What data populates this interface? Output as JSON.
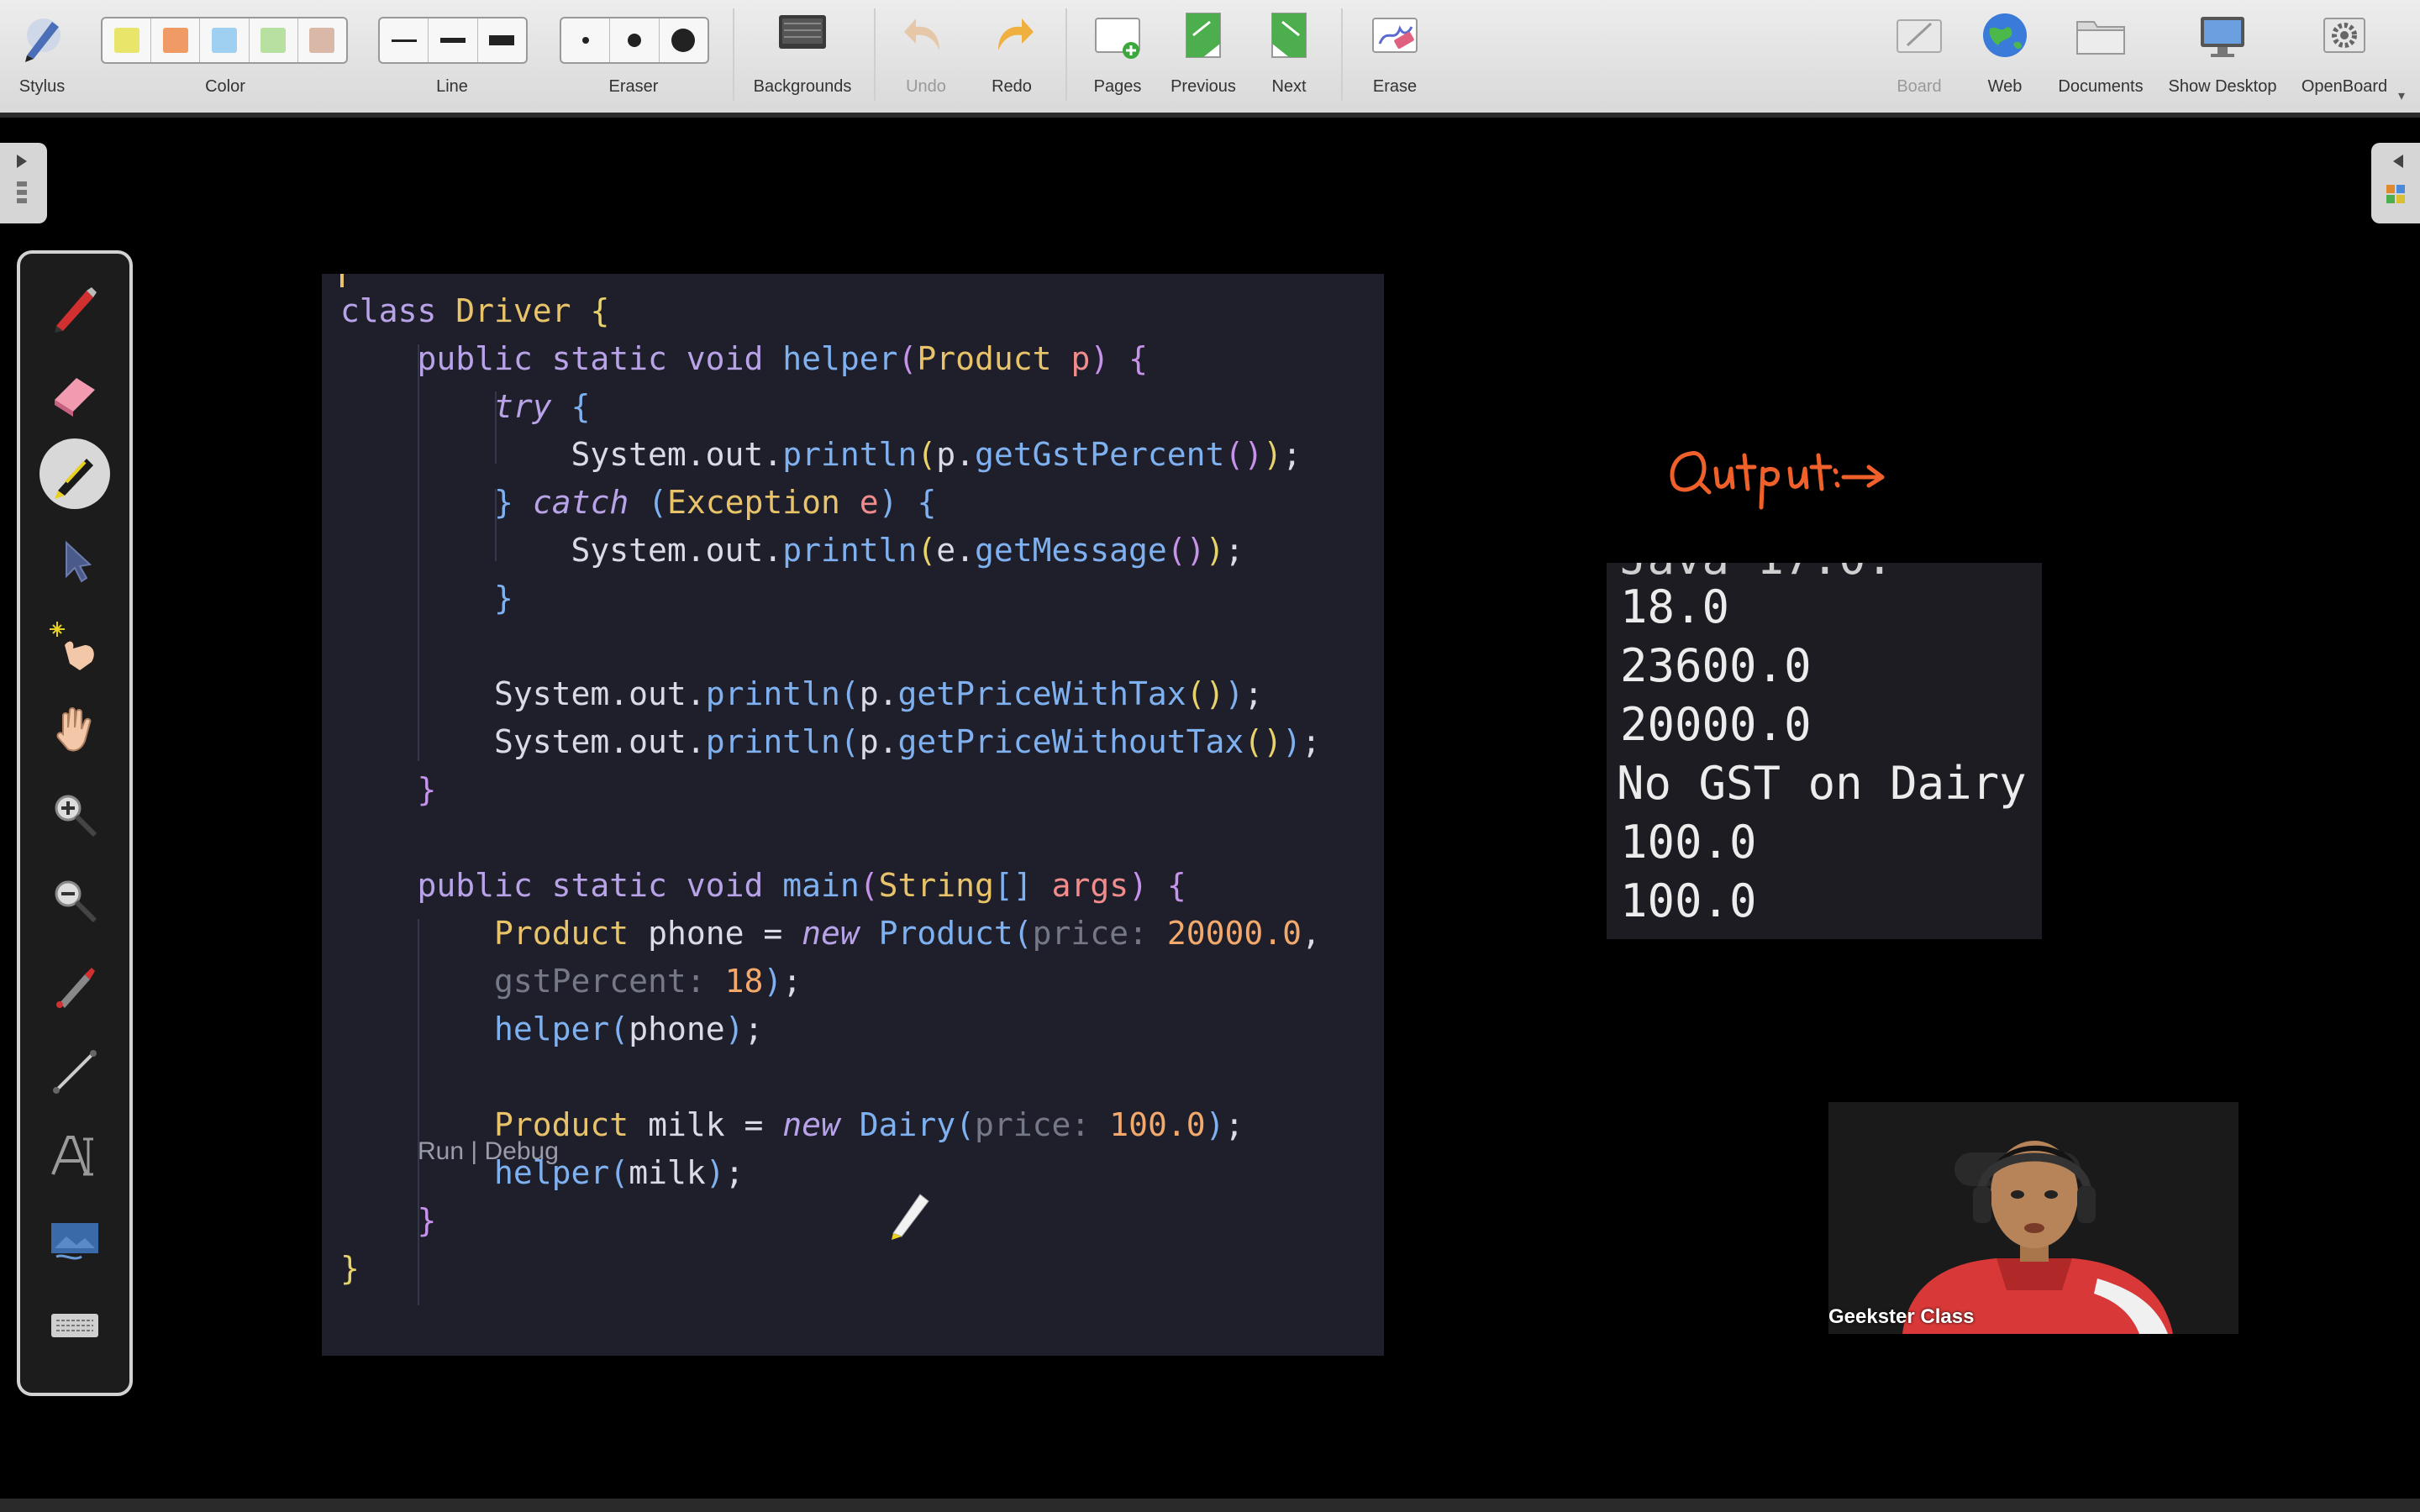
{
  "toolbar": {
    "stylus_label": "Stylus",
    "color_label": "Color",
    "colors": [
      "#e9e46a",
      "#f09a66",
      "#9fd0f2",
      "#b8e0a0",
      "#d9b8a8"
    ],
    "line_label": "Line",
    "eraser_label": "Eraser",
    "backgrounds_label": "Backgrounds",
    "undo_label": "Undo",
    "redo_label": "Redo",
    "pages_label": "Pages",
    "previous_label": "Previous",
    "next_label": "Next",
    "erase_label": "Erase",
    "board_label": "Board",
    "web_label": "Web",
    "documents_label": "Documents",
    "show_desktop_label": "Show Desktop",
    "openboard_label": "OpenBoard"
  },
  "palette": {
    "items": [
      "pen-icon",
      "eraser-icon",
      "marker-icon",
      "selector-icon",
      "laser-pointer-icon",
      "hand-icon",
      "zoom-in-icon",
      "zoom-out-icon",
      "capture-icon",
      "line-icon",
      "text-icon",
      "image-capture-icon",
      "keyboard-icon"
    ],
    "active": "marker-icon"
  },
  "code": {
    "codelens": "Run | Debug"
  },
  "annotation": {
    "text": "Output:→",
    "color": "#f0602a"
  },
  "output": {
    "lines": [
      "18.0",
      "23600.0",
      "20000.0",
      "No GST on Dairy",
      "100.0",
      "100.0"
    ]
  },
  "webcam": {
    "label": "Geekster Class"
  }
}
